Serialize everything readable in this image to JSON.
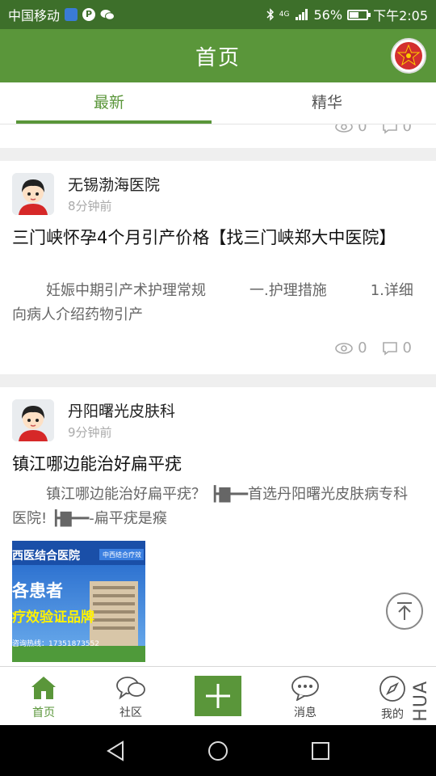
{
  "status_bar": {
    "carrier": "中国移动",
    "network": "4G",
    "battery": "56%",
    "battery_level": 0.56,
    "time": "下午2:05"
  },
  "header": {
    "title": "首页"
  },
  "tabs": [
    {
      "label": "最新",
      "active": true
    },
    {
      "label": "精华",
      "active": false
    }
  ],
  "feed": {
    "stub_card": {
      "views": "0",
      "comments": "0"
    },
    "posts": [
      {
        "author": "无锡渤海医院",
        "time": "8分钟前",
        "title": "三门峡怀孕4个月引产价格【找三门峡郑大中医院】",
        "excerpt": "妊娠中期引产术护理常规　　　一.护理措施　　　1.详细向病人介绍药物引产",
        "views": "0",
        "comments": "0"
      },
      {
        "author": "丹阳曙光皮肤科",
        "time": "9分钟前",
        "title": "镇江哪边能治好扁平疣",
        "excerpt": "镇江哪边能治好扁平疣？ ┣▇━━首选丹阳曙光皮肤病专科医院! ┣▇━━-扁平疣是瘊",
        "image_text": {
          "banner": "西医结合医院",
          "tag": "中西结合疗效",
          "line1": "各患者",
          "line2": "疗效验证品牌",
          "phone": "咨询热线：17351873552"
        }
      }
    ]
  },
  "bottom_nav": [
    {
      "label": "首页",
      "icon": "home-icon",
      "active": true
    },
    {
      "label": "社区",
      "icon": "community-icon",
      "active": false
    },
    {
      "label": "",
      "icon": "add-icon",
      "active": false
    },
    {
      "label": "消息",
      "icon": "message-icon",
      "active": false
    },
    {
      "label": "我的",
      "icon": "compass-icon",
      "active": false
    }
  ],
  "watermark": "HUA",
  "colors": {
    "brand_green": "#5a963a",
    "status_bar": "#3d6f2a"
  }
}
